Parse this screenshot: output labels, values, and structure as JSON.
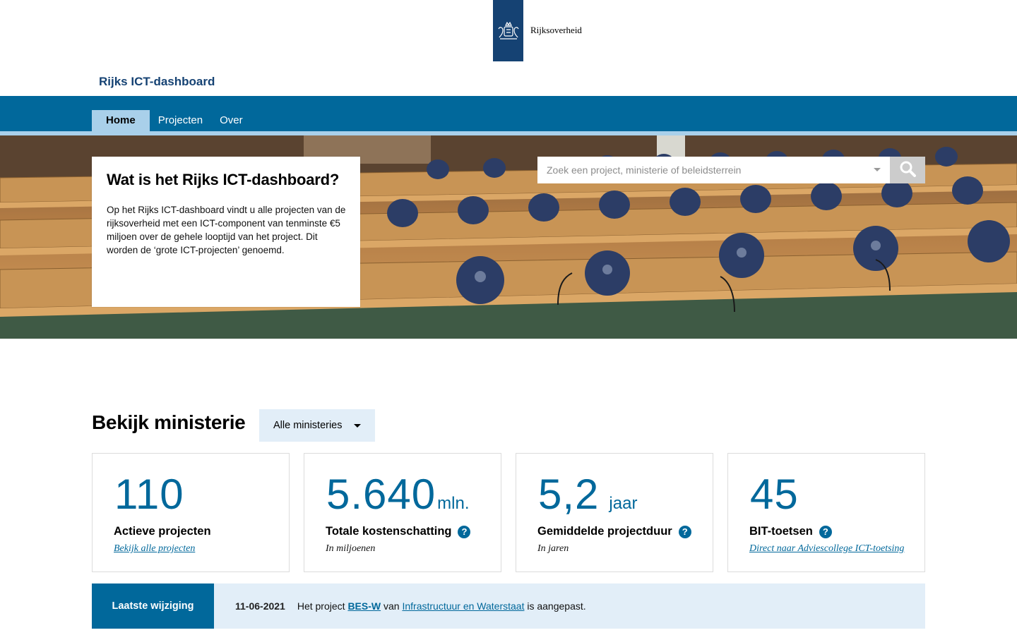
{
  "header": {
    "logo_text": "Rijksoverheid",
    "site_title": "Rijks ICT-dashboard"
  },
  "nav": {
    "items": [
      {
        "label": "Home",
        "active": true
      },
      {
        "label": "Projecten",
        "active": false
      },
      {
        "label": "Over",
        "active": false
      }
    ]
  },
  "hero": {
    "card_title": "Wat is het Rijks ICT-dashboard?",
    "card_text": "Op het Rijks ICT-dashboard vindt u alle projecten van de rijksoverheid met een ICT-component van tenminste €5 miljoen over de gehele looptijd van het project. Dit worden de ‘grote ICT-projecten’ genoemd.",
    "search_placeholder": "Zoek een project, ministerie of beleidsterrein",
    "search_icon": "search-icon"
  },
  "ministry": {
    "title": "Bekijk ministerie",
    "selected": "Alle ministeries"
  },
  "stats": [
    {
      "value": "110",
      "unit": "",
      "label": "Actieve projecten",
      "help": false,
      "sub": "Bekijk alle projecten",
      "sub_is_link": true
    },
    {
      "value": "5.640",
      "unit": "mln.",
      "label": "Totale kostenschatting",
      "help": true,
      "sub": "In miljoenen",
      "sub_is_link": false
    },
    {
      "value": "5,2",
      "unit": "jaar",
      "label": "Gemiddelde projectduur",
      "help": true,
      "sub": "In jaren",
      "sub_is_link": false
    },
    {
      "value": "45",
      "unit": "",
      "label": "BIT-toetsen",
      "help": true,
      "sub": "Direct naar Adviescollege ICT-toetsing",
      "sub_is_link": true
    }
  ],
  "latest_change": {
    "label": "Laatste wijziging",
    "date": "11-06-2021",
    "prefix": "Het project",
    "project": "BES-W",
    "middle": "van",
    "ministry": "Infrastructuur en Waterstaat",
    "suffix": "is aangepast."
  },
  "colors": {
    "primary": "#01689b",
    "brand_dark": "#154273",
    "nav_light": "#a9d0ea",
    "panel_light": "#e2eef8"
  }
}
